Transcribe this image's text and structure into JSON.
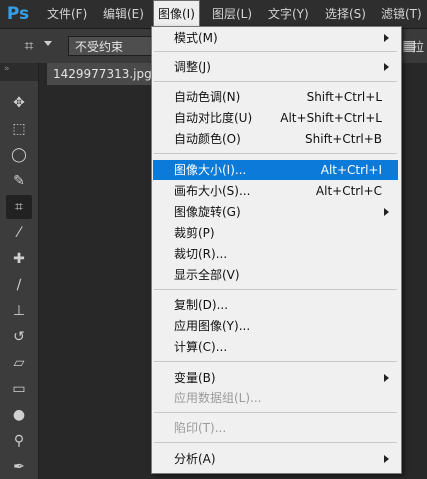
{
  "app": {
    "logo": "Ps"
  },
  "menubar": {
    "items": [
      {
        "label": "文件(F)"
      },
      {
        "label": "编辑(E)"
      },
      {
        "label": "图像(I)"
      },
      {
        "label": "图层(L)"
      },
      {
        "label": "文字(Y)"
      },
      {
        "label": "选择(S)"
      },
      {
        "label": "滤镜(T)"
      }
    ],
    "active_label": "图像(I)"
  },
  "options_bar": {
    "crop_icon": "crop-icon",
    "ratio_value": "不受约束",
    "right_text": "拉"
  },
  "toolbar": {
    "head": "»"
  },
  "document": {
    "tab_title": "1429977313.jpg @"
  },
  "image_menu": {
    "items": [
      {
        "label": "模式(M)",
        "shortcut": "",
        "submenu": true
      },
      {
        "label": "调整(J)",
        "shortcut": "",
        "submenu": true
      },
      {
        "label": "自动色调(N)",
        "shortcut": "Shift+Ctrl+L",
        "submenu": false
      },
      {
        "label": "自动对比度(U)",
        "shortcut": "Alt+Shift+Ctrl+L",
        "submenu": false
      },
      {
        "label": "自动颜色(O)",
        "shortcut": "Shift+Ctrl+B",
        "submenu": false
      },
      {
        "label": "图像大小(I)...",
        "shortcut": "Alt+Ctrl+I",
        "submenu": false
      },
      {
        "label": "画布大小(S)...",
        "shortcut": "Alt+Ctrl+C",
        "submenu": false
      },
      {
        "label": "图像旋转(G)",
        "shortcut": "",
        "submenu": true
      },
      {
        "label": "裁剪(P)",
        "shortcut": "",
        "submenu": false
      },
      {
        "label": "裁切(R)...",
        "shortcut": "",
        "submenu": false
      },
      {
        "label": "显示全部(V)",
        "shortcut": "",
        "submenu": false
      },
      {
        "label": "复制(D)...",
        "shortcut": "",
        "submenu": false
      },
      {
        "label": "应用图像(Y)...",
        "shortcut": "",
        "submenu": false
      },
      {
        "label": "计算(C)...",
        "shortcut": "",
        "submenu": false
      },
      {
        "label": "变量(B)",
        "shortcut": "",
        "submenu": true
      },
      {
        "label": "应用数据组(L)...",
        "shortcut": "",
        "submenu": false,
        "disabled": true
      },
      {
        "label": "陷印(T)...",
        "shortcut": "",
        "submenu": false,
        "disabled": true
      },
      {
        "label": "分析(A)",
        "shortcut": "",
        "submenu": true
      }
    ],
    "highlighted": "图像大小(I)..."
  },
  "colors": {
    "highlight": "#0c7ad8",
    "menu_bg": "#f0f0f0",
    "app_bg": "#2b2b2b",
    "logo": "#35a0e8"
  }
}
